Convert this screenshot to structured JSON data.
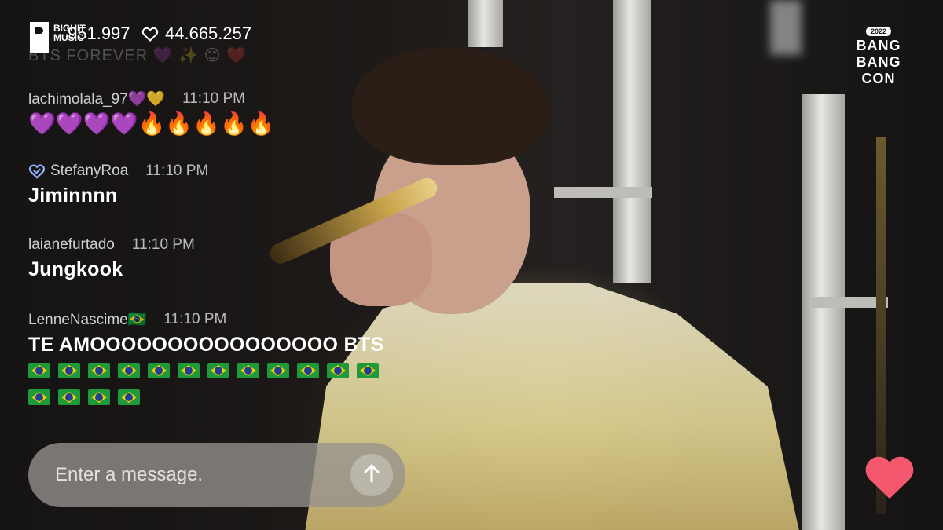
{
  "brand": {
    "logo_text": "BIGHIT MUSIC"
  },
  "stats": {
    "viewers": "951.997",
    "likes": "44.665.257",
    "likes_icon": "heart-outline-icon"
  },
  "event_badge": {
    "year": "2022",
    "line1": "BANG",
    "line2": "BANG",
    "line3": "CON"
  },
  "chat": {
    "faded_message": "BTS FOREVER 💜 ✨ 😊 ❤️",
    "messages": [
      {
        "user": "lachimolala_97💜💛",
        "time": "11:10 PM",
        "text": "💜💜💜💜🔥🔥🔥🔥🔥"
      },
      {
        "user": "StefanyRoa",
        "time": "11:10 PM",
        "text": "Jiminnnn",
        "verified_icon": "heart-badge-icon"
      },
      {
        "user": "laianefurtado",
        "time": "11:10 PM",
        "text": "Jungkook"
      },
      {
        "user": "LenneNascime🇧🇷",
        "time": "11:10 PM",
        "text": "TE AMOOOOOOOOOOOOOOOO BTS",
        "flag_count": 16
      }
    ]
  },
  "composer": {
    "placeholder": "Enter a message.",
    "value": "",
    "send_icon": "arrow-up-icon"
  },
  "reaction": {
    "icon": "heart-icon",
    "color": "#f3586e"
  }
}
